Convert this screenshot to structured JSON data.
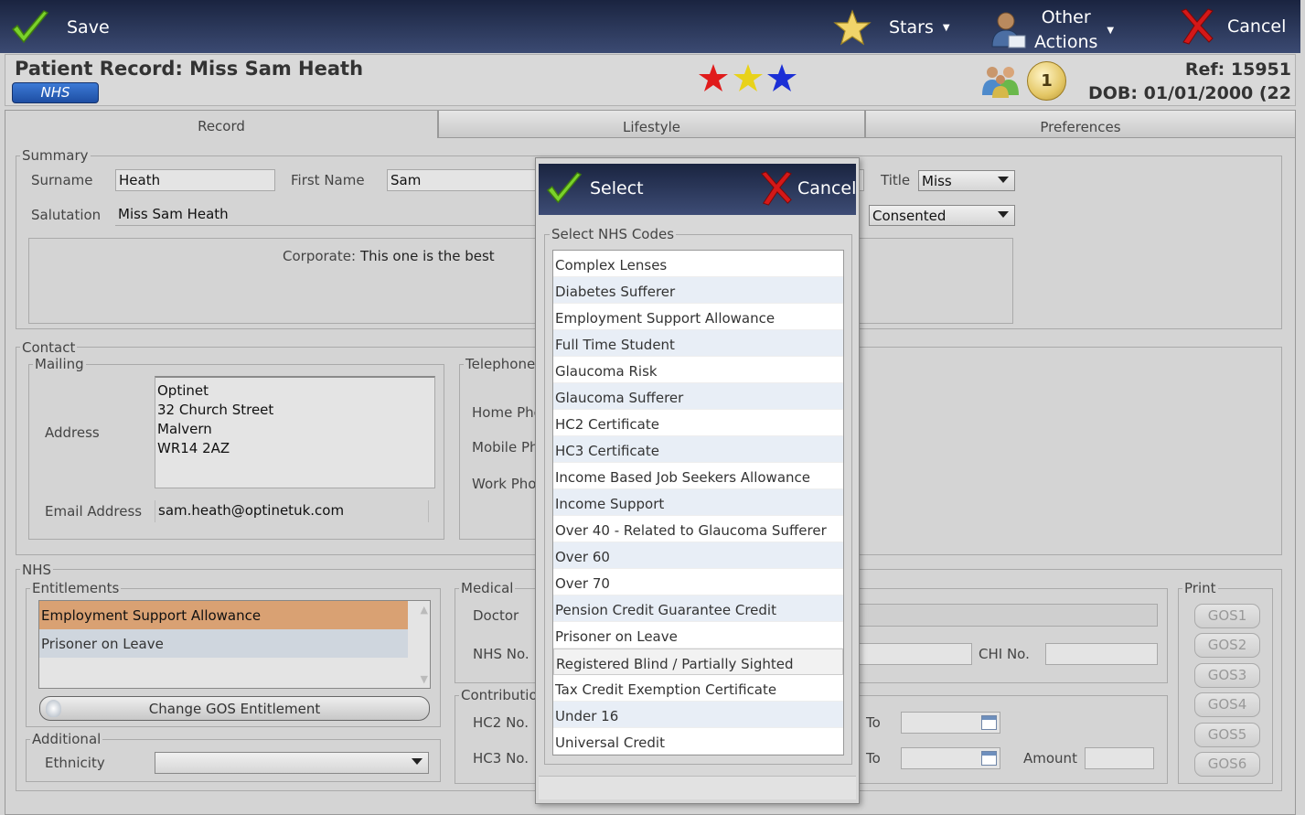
{
  "toolbar": {
    "save_label": "Save",
    "stars_label": "Stars",
    "other_actions_line1": "Other",
    "other_actions_line2": "Actions",
    "cancel_label": "Cancel"
  },
  "header": {
    "title": "Patient Record: Miss Sam Heath",
    "badge": "NHS",
    "ref": "Ref: 15951",
    "dob": "DOB: 01/01/2000 (22",
    "counter": "1",
    "star_colors": [
      "#e01b1b",
      "#e8d21a",
      "#1b2fd6"
    ]
  },
  "tabs": [
    {
      "label": "Record"
    },
    {
      "label": "Lifestyle"
    },
    {
      "label": "Preferences"
    }
  ],
  "summary": {
    "legend": "Summary",
    "surname_label": "Surname",
    "surname_value": "Heath",
    "first_name_label": "First Name",
    "first_name_value": "Sam",
    "title_label": "Title",
    "title_value": "Miss",
    "salutation_label": "Salutation",
    "salutation_value": "Miss Sam Heath",
    "consent_value": "Consented",
    "corporate_label": "Corporate:",
    "corporate_value": "This one is the best"
  },
  "contact": {
    "legend": "Contact",
    "mailing_legend": "Mailing",
    "address_label": "Address",
    "address_lines": [
      "Optinet",
      "32 Church Street",
      "Malvern",
      "WR14 2AZ"
    ],
    "email_label": "Email Address",
    "email_value": "sam.heath@optinetuk.com",
    "telephone_legend": "Telephone I",
    "home_phone_label": "Home Pho",
    "mobile_phone_label": "Mobile Ph",
    "work_phone_label": "Work Pho"
  },
  "nhs": {
    "legend": "NHS",
    "entitlements_legend": "Entitlements",
    "entitlements": [
      "Employment Support Allowance",
      "Prisoner on Leave"
    ],
    "change_gos_label": "Change GOS Entitlement",
    "additional_legend": "Additional",
    "ethnicity_label": "Ethnicity",
    "ethnicity_value": "",
    "medical_legend": "Medical",
    "doctor_label": "Doctor",
    "nhs_no_label": "NHS No.",
    "chi_no_label": "CHI No.",
    "contributions_legend": "Contribution",
    "hc2_label": "HC2 No.",
    "hc3_label": "HC3 No.",
    "to_label": "To",
    "amount_label": "Amount",
    "print_legend": "Print",
    "print_buttons": [
      "GOS1",
      "GOS2",
      "GOS3",
      "GOS4",
      "GOS5",
      "GOS6"
    ]
  },
  "modal": {
    "select_label": "Select",
    "cancel_label": "Cancel",
    "group_legend": "Select NHS Codes",
    "codes": [
      "Complex Lenses",
      "Diabetes Sufferer",
      "Employment Support Allowance",
      "Full Time Student",
      "Glaucoma Risk",
      "Glaucoma Sufferer",
      "HC2 Certificate",
      "HC3 Certificate",
      "Income Based Job Seekers Allowance",
      "Income Support",
      "Over 40 - Related to Glaucoma Sufferer",
      "Over 60",
      "Over 70",
      "Pension Credit Guarantee Credit",
      "Prisoner on Leave",
      "Registered Blind / Partially Sighted",
      "Tax Credit Exemption Certificate",
      "Under 16",
      "Universal Credit"
    ]
  }
}
